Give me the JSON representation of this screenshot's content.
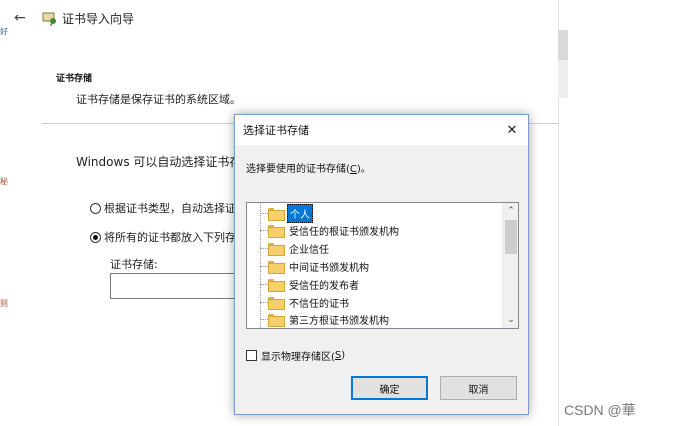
{
  "wizard": {
    "title": "证书导入向导",
    "section_heading": "证书存储",
    "section_desc": "证书存储是保存证书的系统区域。",
    "auto_text": "Windows 可以自动选择证书存储",
    "option_auto": "根据证书类型，自动选择证",
    "option_manual": "将所有的证书都放入下列存",
    "store_label": "证书存储:",
    "store_value": ""
  },
  "dialog": {
    "title": "选择证书存储",
    "close": "✕",
    "prompt_pre": "选择要使用的证书存储(",
    "prompt_key": "C",
    "prompt_post": ")。",
    "items": [
      {
        "label": "个人",
        "selected": true
      },
      {
        "label": "受信任的根证书颁发机构",
        "selected": false
      },
      {
        "label": "企业信任",
        "selected": false
      },
      {
        "label": "中间证书颁发机构",
        "selected": false
      },
      {
        "label": "受信任的发布者",
        "selected": false
      },
      {
        "label": "不信任的证书",
        "selected": false
      },
      {
        "label": "第三方根证书颁发机构",
        "selected": false
      }
    ],
    "show_physical_pre": "显示物理存储区(",
    "show_physical_key": "S",
    "show_physical_post": ")",
    "show_physical_checked": false,
    "ok_label": "确定",
    "cancel_label": "取消"
  },
  "watermark": "CSDN @華",
  "colors": {
    "selection": "#0078d7",
    "folder": "#f4cf6a"
  }
}
